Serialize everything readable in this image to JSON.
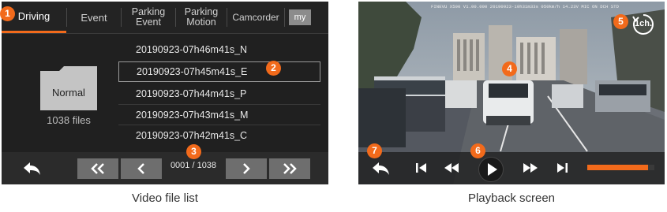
{
  "left_panel": {
    "tabs": [
      {
        "label": "Driving"
      },
      {
        "label": "Event"
      },
      {
        "label": "Parking\nEvent"
      },
      {
        "label": "Parking\nMotion"
      },
      {
        "label": "Camcorder"
      },
      {
        "label": "my"
      }
    ],
    "folder": {
      "label": "Normal",
      "count": "1038 files"
    },
    "files": [
      "20190923-07h46m41s_N",
      "20190923-07h45m41s_E",
      "20190923-07h44m41s_P",
      "20190923-07h43m41s_M",
      "20190923-07h42m41s_C"
    ],
    "selected_index": 1,
    "page_counter": "0001 / 1038",
    "caption": "Video file list"
  },
  "right_panel": {
    "overlay_text": "FINEVU X500 V1.00.000  20190923-10h31m33s  050km/h  14.23V  MIC ON  DCH STD",
    "channel_label": "1ch.",
    "progress": 0.9,
    "caption": "Playback screen"
  },
  "markers": [
    "1",
    "2",
    "3",
    "4",
    "5",
    "6",
    "7"
  ],
  "colors": {
    "accent": "#f26a1b",
    "panel_bg": "#202020",
    "button_bg": "#6e6e6e"
  },
  "icons": {
    "back": "back-arrow-icon",
    "rewind_fast": "double-chevron-left-icon",
    "prev": "chevron-left-icon",
    "next": "chevron-right-icon",
    "forward_fast": "double-chevron-right-icon",
    "skip_prev": "skip-previous-icon",
    "rewind": "rewind-icon",
    "play": "play-icon",
    "forward": "fast-forward-icon",
    "skip_next": "skip-next-icon",
    "channel": "channel-switch-icon",
    "folder": "folder-icon"
  }
}
